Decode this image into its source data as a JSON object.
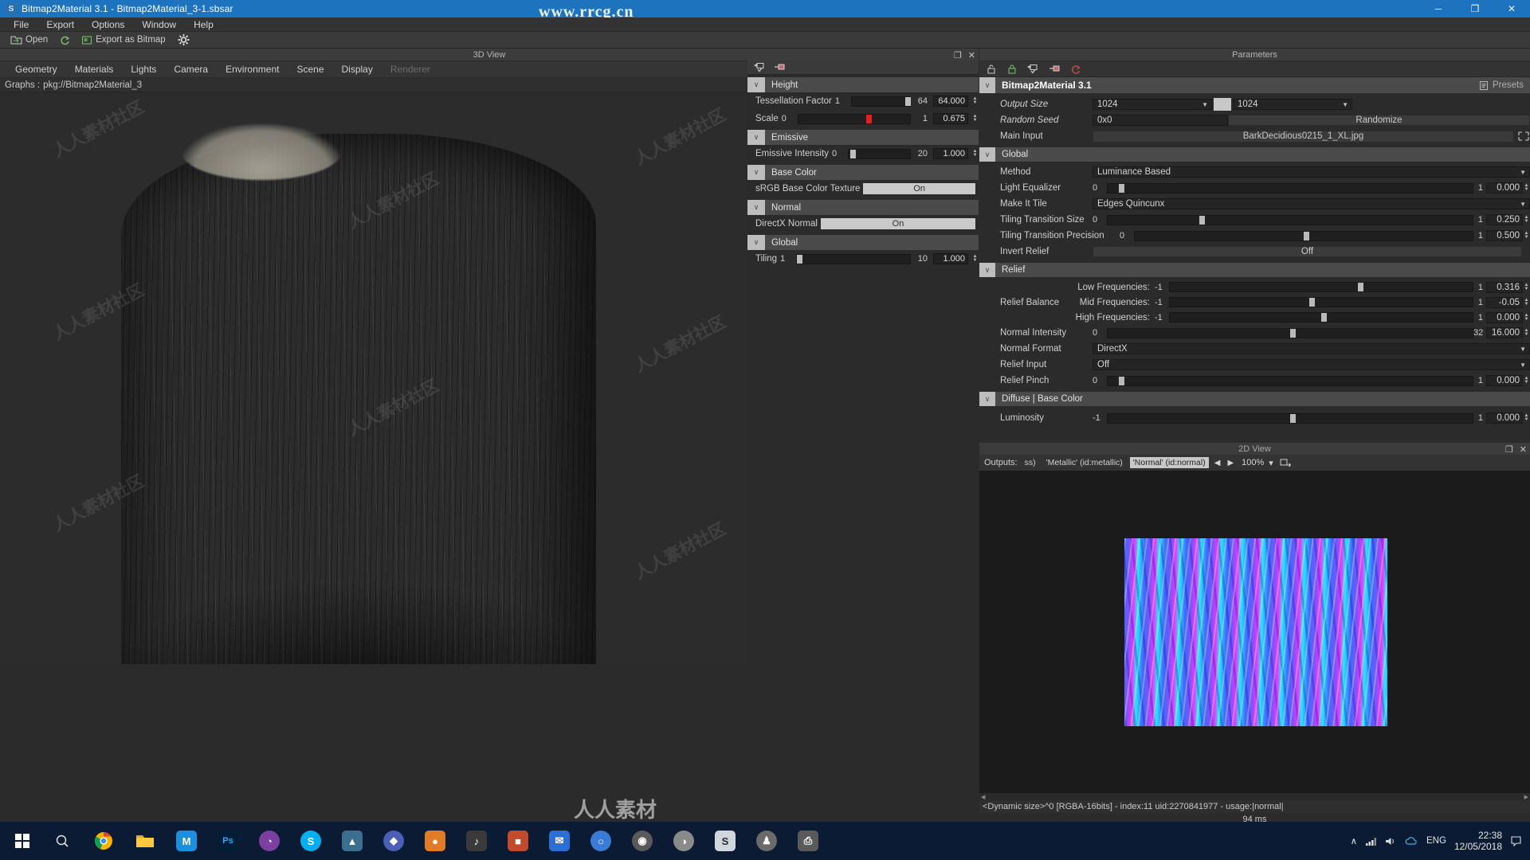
{
  "window": {
    "title": "Bitmap2Material 3.1 - Bitmap2Material_3-1.sbsar",
    "icon": "app-icon",
    "minimize": "─",
    "maximize": "❐",
    "close": "✕"
  },
  "watermarks": {
    "top": "www.rrcg.cn",
    "bottom": "人人素材",
    "tile": "人人素材社区"
  },
  "menu": [
    "File",
    "Export",
    "Options",
    "Window",
    "Help"
  ],
  "toolbar": {
    "open": "Open",
    "refresh_icon": "refresh-icon",
    "export_as_bitmap": "Export as Bitmap",
    "settings_icon": "gear-icon"
  },
  "viewport": {
    "panel_title": "3D View",
    "restore_icon": "❐",
    "close_icon": "✕",
    "tabs": [
      "Geometry",
      "Materials",
      "Lights",
      "Camera",
      "Environment",
      "Scene",
      "Display"
    ],
    "disabled_tab": "Renderer",
    "graphs_label": "Graphs :",
    "graphs_path": "pkg://Bitmap2Material_3",
    "materials_select": "Materials",
    "caret": "▾"
  },
  "mid_panel": {
    "toolbar_icons": [
      "import-icon",
      "export-icon"
    ],
    "groups": [
      {
        "name": "Height",
        "chevron": "∨",
        "rows": [
          {
            "label": "Tessellation Factor",
            "min": "1",
            "max": "64",
            "value": "64.000",
            "knob_pct": 92,
            "fill_pct": 0
          },
          {
            "label": "Scale",
            "min": "0",
            "max": "1",
            "value": "0.675",
            "knob_pct": 61,
            "fill_pct": 0,
            "knob_color": "red"
          }
        ]
      },
      {
        "name": "Emissive",
        "chevron": "∨",
        "rows": [
          {
            "label": "Emissive Intensity",
            "min": "0",
            "max": "20",
            "value": "1.000",
            "knob_pct": 4,
            "fill_pct": 0
          }
        ]
      },
      {
        "name": "Base Color",
        "chevron": "∨",
        "toggles": [
          {
            "label": "sRGB Base Color Texture",
            "state": "On"
          }
        ]
      },
      {
        "name": "Normal",
        "chevron": "∨",
        "toggles": [
          {
            "label": "DirectX Normal",
            "state": "On"
          }
        ]
      },
      {
        "name": "Global",
        "chevron": "∨",
        "rows": [
          {
            "label": "Tiling",
            "min": "1",
            "max": "10",
            "value": "1.000",
            "knob_pct": 1,
            "fill_pct": 0
          }
        ]
      }
    ]
  },
  "parameters": {
    "panel_title": "Parameters",
    "restore_icon": "❐",
    "close_icon": "✕",
    "toolbar_icons": [
      "unlock-icon",
      "lock-icon",
      "import-icon",
      "export-icon",
      "reset-icon"
    ],
    "graph_title": "Bitmap2Material 3.1",
    "chevron": "∨",
    "presets_label": "Presets",
    "presets_icon": "presets-icon",
    "base_rows": [
      {
        "label": "Output Size",
        "type": "size",
        "w": "1024",
        "h": "1024",
        "italic": true
      },
      {
        "label": "Random Seed",
        "type": "seed",
        "value": "0x0",
        "button": "Randomize",
        "italic": true
      },
      {
        "label": "Main Input",
        "type": "input",
        "value": "BarkDecidious0215_1_XL.jpg",
        "icon": "fit-icon",
        "italic": false
      }
    ],
    "sections": [
      {
        "name": "Global",
        "rows": [
          {
            "label": "Method",
            "type": "combo",
            "value": "Luminance Based"
          },
          {
            "label": "Light Equalizer",
            "type": "slider",
            "min": "0",
            "max": "1",
            "value": "0.000",
            "knob_pct": 3
          },
          {
            "label": "Make It Tile",
            "type": "combo",
            "value": "Edges Quincunx"
          },
          {
            "label": "Tiling Transition Size",
            "type": "slider",
            "min": "0",
            "max": "1",
            "value": "0.250",
            "knob_pct": 25
          },
          {
            "label": "Tiling Transition Precision",
            "type": "slider",
            "min": "0",
            "max": "1",
            "value": "0.500",
            "knob_pct": 50
          },
          {
            "label": "Invert Relief",
            "type": "toggle",
            "value": "Off"
          }
        ]
      },
      {
        "name": "Relief",
        "rows": [
          {
            "label": "Relief Balance",
            "type": "multi",
            "sub": [
              {
                "name": "Low Frequencies:",
                "min": "-1",
                "max": "1",
                "value": "0.316",
                "knob_pct": 62
              },
              {
                "name": "Mid Frequencies:",
                "min": "-1",
                "max": "1",
                "value": "-0.05",
                "knob_pct": 46
              },
              {
                "name": "High Frequencies:",
                "min": "-1",
                "max": "1",
                "value": "0.000",
                "knob_pct": 50
              }
            ]
          },
          {
            "label": "Normal Intensity",
            "type": "slider",
            "min": "0",
            "max": "32",
            "value": "16.000",
            "knob_pct": 50
          },
          {
            "label": "Normal Format",
            "type": "combo",
            "value": "DirectX"
          },
          {
            "label": "Relief Input",
            "type": "combo",
            "value": "Off"
          },
          {
            "label": "Relief Pinch",
            "type": "slider",
            "min": "0",
            "max": "1",
            "value": "0.000",
            "knob_pct": 3
          }
        ]
      },
      {
        "name": "Diffuse | Base Color",
        "rows": [
          {
            "label": "Luminosity",
            "type": "slider",
            "min": "-1",
            "max": "1",
            "value": "0.000",
            "knob_pct": 50
          }
        ]
      }
    ]
  },
  "view2d": {
    "panel_title": "2D View",
    "restore_icon": "❐",
    "close_icon": "✕",
    "outputs_label": "Outputs:",
    "chips": [
      "ss)",
      "'Metallic' (id:metallic)",
      "'Normal' (id:normal)"
    ],
    "selected_chip_index": 2,
    "prev_icon": "◀",
    "next_icon": "▶",
    "zoom": "100%",
    "zoom_caret": "▾",
    "export_icon": "export-image-icon",
    "status": "<Dynamic size>^0 [RGBA-16bits] - index:11 uid:2270841977 - usage:|normal|",
    "render_time": "94 ms"
  },
  "taskbar": {
    "start_icon": "windows-icon",
    "items": [
      {
        "name": "search",
        "glyph": "○",
        "color": "#0a1b33"
      },
      {
        "name": "chrome",
        "glyph": "●",
        "color": "#e8483a"
      },
      {
        "name": "file-explorer",
        "glyph": "▭",
        "color": "#ffc83d"
      },
      {
        "name": "media-player",
        "glyph": "M",
        "color": "#1b8fe0"
      },
      {
        "name": "photoshop",
        "glyph": "Ps",
        "color": "#001e36"
      },
      {
        "name": "firefox",
        "glyph": "◔",
        "color": "#7a3fa0"
      },
      {
        "name": "skype",
        "glyph": "S",
        "color": "#00aff0"
      },
      {
        "name": "3dsmax",
        "glyph": "▲",
        "color": "#3b6e8f"
      },
      {
        "name": "substance-designer",
        "glyph": "◆",
        "color": "#4a5fb5"
      },
      {
        "name": "substance-painter",
        "glyph": "●",
        "color": "#e07b26"
      },
      {
        "name": "speaker-app",
        "glyph": "♪",
        "color": "#3a3a3a"
      },
      {
        "name": "unity",
        "glyph": "■",
        "color": "#c44a2e"
      },
      {
        "name": "mail",
        "glyph": "✉",
        "color": "#2b6fd4"
      },
      {
        "name": "zbrush",
        "glyph": "○",
        "color": "#3a7bd5"
      },
      {
        "name": "marmoset",
        "glyph": "◉",
        "color": "#5a5a5a"
      },
      {
        "name": "keyshot",
        "glyph": "◑",
        "color": "#8a8a8a"
      },
      {
        "name": "calculator",
        "glyph": "□",
        "color": "#4a4a4a"
      },
      {
        "name": "substance-active",
        "glyph": "S",
        "color": "#cfd6dd"
      },
      {
        "name": "person",
        "glyph": "♟",
        "color": "#6a6a6a"
      },
      {
        "name": "printer",
        "glyph": "⎙",
        "color": "#5a5a5a"
      }
    ],
    "tray": {
      "caret": "∧",
      "network_icon": "network-icon",
      "volume_icon": "volume-icon",
      "cloud_icon": "cloud-icon",
      "language": "ENG",
      "time": "22:38",
      "date": "12/05/2018",
      "notif_icon": "notification-icon"
    }
  }
}
